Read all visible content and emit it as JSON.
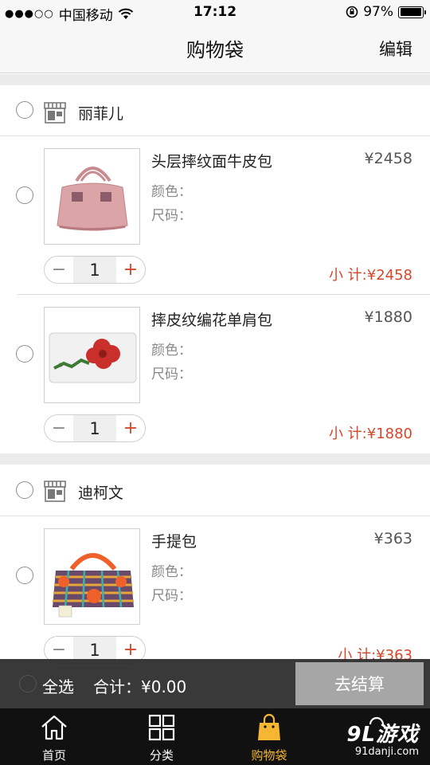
{
  "status_bar": {
    "carrier": "中国移动",
    "time": "17:12",
    "battery": "97%"
  },
  "nav": {
    "title": "购物袋",
    "edit": "编辑"
  },
  "shops": [
    {
      "name": "丽菲儿",
      "items": [
        {
          "name": "头层摔纹面牛皮包",
          "price": "¥2458",
          "color_label": "颜色：",
          "size_label": "尺码：",
          "quantity": "1",
          "subtotal": "小 计:¥2458"
        },
        {
          "name": "摔皮纹编花单肩包",
          "price": "¥1880",
          "color_label": "颜色：",
          "size_label": "尺码：",
          "quantity": "1",
          "subtotal": "小 计:¥1880"
        }
      ]
    },
    {
      "name": "迪柯文",
      "items": [
        {
          "name": "手提包",
          "price": "¥363",
          "color_label": "颜色：",
          "size_label": "尺码：",
          "quantity": "1",
          "subtotal": "小 计:¥363"
        }
      ]
    }
  ],
  "stepper": {
    "minus": "−",
    "plus": "+"
  },
  "checkout": {
    "select_all": "全选",
    "total": "合计：¥0.00",
    "button": "去结算"
  },
  "tabs": [
    {
      "label": "首页",
      "icon": "home-icon"
    },
    {
      "label": "分类",
      "icon": "grid-icon"
    },
    {
      "label": "购物袋",
      "icon": "bag-icon",
      "active": true
    },
    {
      "label": "",
      "icon": "profile-icon"
    }
  ],
  "watermark": {
    "logo": "9L游戏",
    "site": "91danji.com"
  },
  "colors": {
    "accent": "#d9462a",
    "tab_active": "#f5b731",
    "checkout_button": "#a6a6a6"
  }
}
